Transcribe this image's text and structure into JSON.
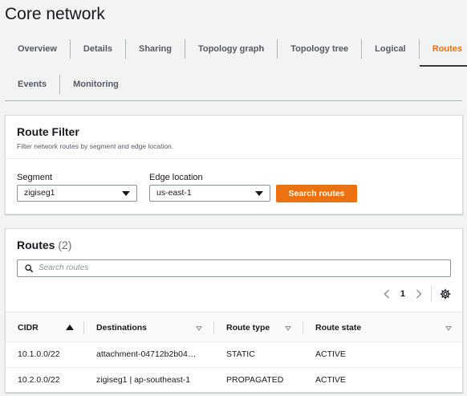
{
  "page": {
    "title": "Core network"
  },
  "tabs": [
    {
      "label": "Overview",
      "active": false
    },
    {
      "label": "Details",
      "active": false
    },
    {
      "label": "Sharing",
      "active": false
    },
    {
      "label": "Topology graph",
      "active": false
    },
    {
      "label": "Topology tree",
      "active": false
    },
    {
      "label": "Logical",
      "active": false
    },
    {
      "label": "Routes",
      "active": true
    },
    {
      "label": "Events",
      "active": false
    },
    {
      "label": "Monitoring",
      "active": false
    }
  ],
  "route_filter": {
    "title": "Route Filter",
    "description": "Filter network routes by segment and edge location.",
    "segment": {
      "label": "Segment",
      "value": "zigiseg1"
    },
    "edge_location": {
      "label": "Edge location",
      "value": "us-east-1"
    },
    "search_button": "Search routes"
  },
  "routes": {
    "title": "Routes",
    "count": "(2)",
    "search_placeholder": "Search routes",
    "page_number": "1",
    "columns": [
      "CIDR",
      "Destinations",
      "Route type",
      "Route state"
    ],
    "rows": [
      {
        "cidr": "10.1.0.0/22",
        "destination": "attachment-04712b2b04…",
        "type": "STATIC",
        "state": "ACTIVE"
      },
      {
        "cidr": "10.2.0.0/22",
        "destination": "zigiseg1 | ap-southeast-1",
        "type": "PROPAGATED",
        "state": "ACTIVE"
      }
    ]
  },
  "colors": {
    "accent": "#ec7211",
    "text": "#16191f",
    "muted": "#545b64",
    "border": "#aab7b8"
  }
}
